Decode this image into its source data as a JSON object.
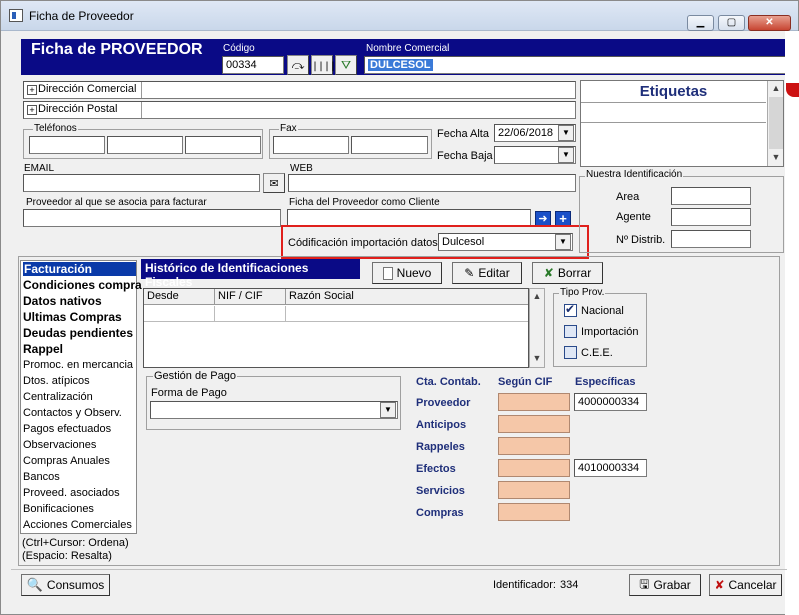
{
  "window": {
    "title": "Ficha de Proveedor"
  },
  "header": {
    "title": "Ficha de PROVEEDOR",
    "codigo_label": "Código",
    "codigo_value": "00334",
    "nombre_label": "Nombre Comercial",
    "nombre_value": "DULCESOL"
  },
  "address": {
    "comercial_label": "Dirección Comercial",
    "postal_label": "Dirección Postal"
  },
  "etiquetas": {
    "title": "Etiquetas"
  },
  "contact": {
    "telefonos_label": "Teléfonos",
    "fax_label": "Fax",
    "fecha_alta_label": "Fecha Alta",
    "fecha_alta_value": "22/06/2018",
    "fecha_baja_label": "Fecha Baja",
    "email_label": "EMAIL",
    "web_label": "WEB"
  },
  "associations": {
    "proveedor_facturar_label": "Proveedor al que se asocia para facturar",
    "ficha_cliente_label": "Ficha del Proveedor como Cliente",
    "codificacion_label": "Códificación importación datos",
    "codificacion_value": "Dulcesol"
  },
  "identificacion": {
    "title": "Nuestra Identificación",
    "area_label": "Area",
    "agente_label": "Agente",
    "distrib_label": "Nº Distrib."
  },
  "sidebar": {
    "items": [
      {
        "label": "Facturación"
      },
      {
        "label": "Condiciones compra"
      },
      {
        "label": "Datos nativos"
      },
      {
        "label": "Ultimas Compras"
      },
      {
        "label": "Deudas pendientes"
      },
      {
        "label": "Rappel"
      },
      {
        "label": "Promoc. en mercancia"
      },
      {
        "label": "Dtos. atípicos"
      },
      {
        "label": "Centralización"
      },
      {
        "label": "Contactos y Observ."
      },
      {
        "label": "Pagos efectuados"
      },
      {
        "label": "Observaciones"
      },
      {
        "label": "Compras Anuales"
      },
      {
        "label": "Bancos"
      },
      {
        "label": "Proveed. asociados"
      },
      {
        "label": "Bonificaciones"
      },
      {
        "label": "Acciones Comerciales"
      }
    ],
    "hint1": "(Ctrl+Cursor: Ordena)",
    "hint2": "(Espacio: Resalta)"
  },
  "historico": {
    "title": "Histórico de Identificaciones Fiscales",
    "nuevo": "Nuevo",
    "editar": "Editar",
    "borrar": "Borrar",
    "columns": [
      "Desde",
      "NIF / CIF",
      "Razón Social"
    ]
  },
  "tipo_prov": {
    "title": "Tipo Prov.",
    "options": [
      "Nacional",
      "Importación",
      "C.E.E."
    ],
    "selected": "Nacional"
  },
  "pago": {
    "title": "Gestión de Pago",
    "forma_label": "Forma de Pago"
  },
  "cuentas": {
    "cta_label": "Cta. Contab.",
    "segun_label": "Según CIF",
    "especificas_label": "Específicas",
    "rows": [
      {
        "label": "Proveedor",
        "especifica": "4000000334"
      },
      {
        "label": "Anticipos",
        "especifica": ""
      },
      {
        "label": "Rappeles",
        "especifica": ""
      },
      {
        "label": "Efectos",
        "especifica": "4010000334"
      },
      {
        "label": "Servicios",
        "especifica": ""
      },
      {
        "label": "Compras",
        "especifica": ""
      }
    ]
  },
  "footer": {
    "consumos": "Consumos",
    "identificador_label": "Identificador:",
    "identificador_value": "334",
    "grabar": "Grabar",
    "cancelar": "Cancelar"
  },
  "colors": {
    "header_blue": "#0a0a86",
    "selection_blue": "#0a3aa8",
    "peach": "#f5c7a8",
    "highlight_red": "#e0201c"
  }
}
